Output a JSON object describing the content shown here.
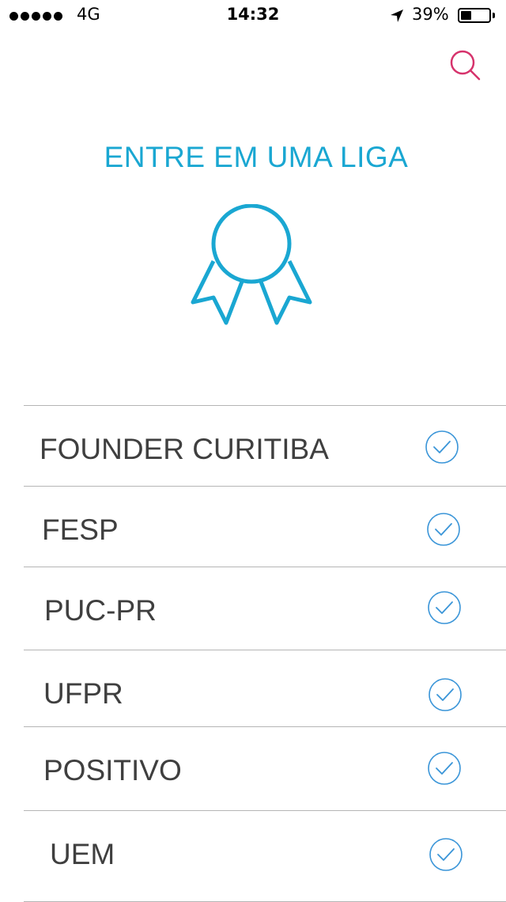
{
  "status_bar": {
    "carrier": "4G",
    "time": "14:32",
    "battery_percent": "39%",
    "battery_level": 0.39
  },
  "header": {
    "search_icon": "search-icon"
  },
  "main": {
    "title": "ENTRE EM UMA LIGA",
    "medal_icon": "medal-ribbon-icon",
    "accent_color": "#1aa7d2",
    "search_color": "#d6336c"
  },
  "leagues": [
    {
      "name": "FOUNDER CURITIBA",
      "icon": "check-circle-icon"
    },
    {
      "name": "FESP",
      "icon": "check-circle-icon"
    },
    {
      "name": "PUC-PR",
      "icon": "check-circle-icon"
    },
    {
      "name": "UFPR",
      "icon": "check-circle-icon"
    },
    {
      "name": "POSITIVO",
      "icon": "check-circle-icon"
    },
    {
      "name": "UEM",
      "icon": "check-circle-icon"
    }
  ]
}
